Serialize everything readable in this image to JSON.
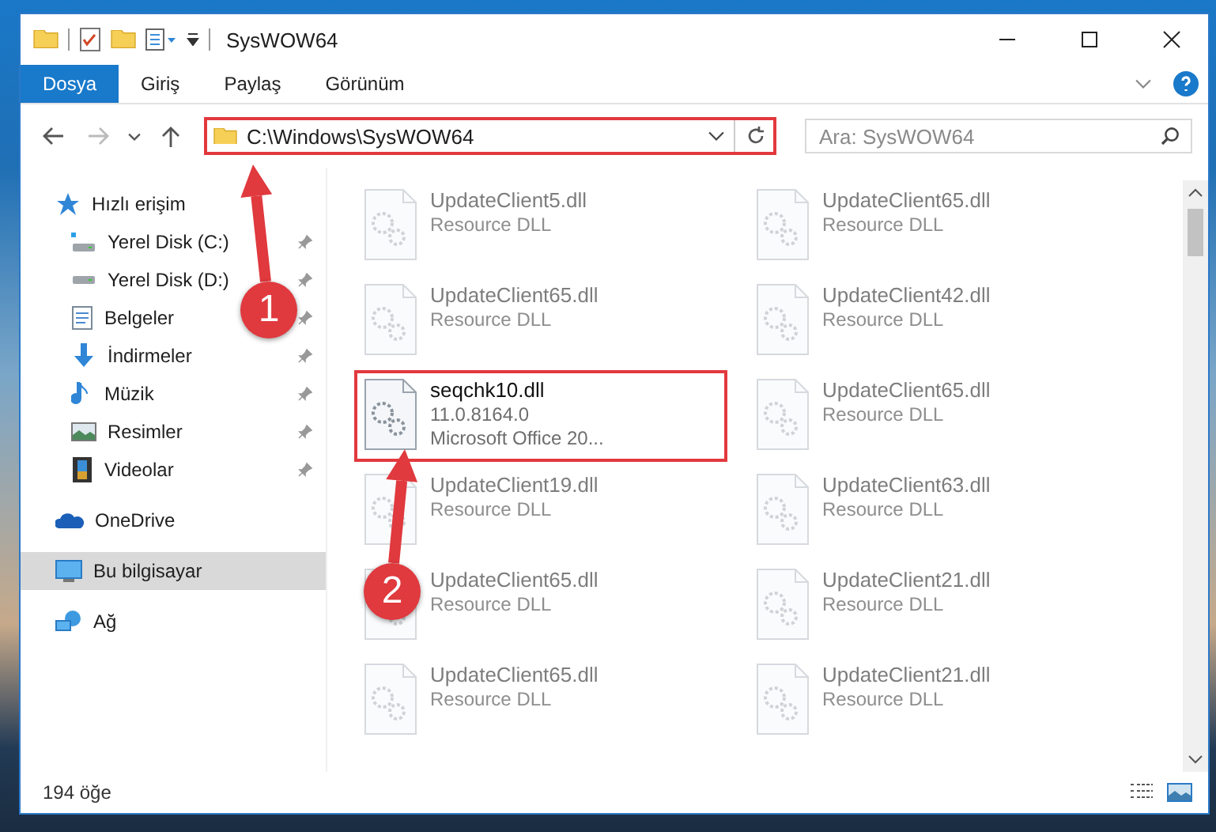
{
  "window": {
    "title": "SysWOW64"
  },
  "ribbon_tabs": [
    {
      "label": "Dosya",
      "selected": true
    },
    {
      "label": "Giriş",
      "selected": false
    },
    {
      "label": "Paylaş",
      "selected": false
    },
    {
      "label": "Görünüm",
      "selected": false
    }
  ],
  "address_bar": {
    "path": "C:\\Windows\\SysWOW64",
    "highlighted": true
  },
  "search": {
    "placeholder": "Ara: SysWOW64"
  },
  "sidebar": {
    "items": [
      {
        "label": "Hızlı erişim",
        "selected": false,
        "children": [
          {
            "label": "Yerel Disk (C:)",
            "pinned": true,
            "selected": false
          },
          {
            "label": "Yerel Disk (D:)",
            "pinned": true,
            "selected": false
          },
          {
            "label": "Belgeler",
            "pinned": true,
            "selected": false
          },
          {
            "label": "İndirmeler",
            "pinned": true,
            "selected": false
          },
          {
            "label": "Müzik",
            "pinned": true,
            "selected": false
          },
          {
            "label": "Resimler",
            "pinned": true,
            "selected": false
          },
          {
            "label": "Videolar",
            "pinned": true,
            "selected": false
          }
        ]
      },
      {
        "label": "OneDrive",
        "selected": false
      },
      {
        "label": "Bu bilgisayar",
        "selected": true
      },
      {
        "label": "Ağ",
        "selected": false
      }
    ]
  },
  "files": [
    {
      "name": "UpdateClient5.dll",
      "details": [
        "Resource DLL"
      ],
      "faded": true,
      "highlighted": false
    },
    {
      "name": "UpdateClient65.dll",
      "details": [
        "Resource DLL"
      ],
      "faded": true,
      "highlighted": false
    },
    {
      "name": "UpdateClient65.dll",
      "details": [
        "Resource DLL"
      ],
      "faded": true,
      "highlighted": false
    },
    {
      "name": "UpdateClient42.dll",
      "details": [
        "Resource DLL"
      ],
      "faded": true,
      "highlighted": false
    },
    {
      "name": "seqchk10.dll",
      "details": [
        "11.0.8164.0",
        "Microsoft Office 20..."
      ],
      "faded": false,
      "highlighted": true
    },
    {
      "name": "UpdateClient65.dll",
      "details": [
        "Resource DLL"
      ],
      "faded": true,
      "highlighted": false
    },
    {
      "name": "UpdateClient19.dll",
      "details": [
        "Resource DLL"
      ],
      "faded": true,
      "highlighted": false
    },
    {
      "name": "UpdateClient63.dll",
      "details": [
        "Resource DLL"
      ],
      "faded": true,
      "highlighted": false
    },
    {
      "name": "UpdateClient65.dll",
      "details": [
        "Resource DLL"
      ],
      "faded": true,
      "highlighted": false
    },
    {
      "name": "UpdateClient21.dll",
      "details": [
        "Resource DLL"
      ],
      "faded": true,
      "highlighted": false
    },
    {
      "name": "UpdateClient65.dll",
      "details": [
        "Resource DLL"
      ],
      "faded": true,
      "highlighted": false
    },
    {
      "name": "UpdateClient21.dll",
      "details": [
        "Resource DLL"
      ],
      "faded": true,
      "highlighted": false
    }
  ],
  "status_bar": {
    "item_count": "194 öğe"
  },
  "annotations": [
    {
      "number": "1"
    },
    {
      "number": "2"
    }
  ]
}
